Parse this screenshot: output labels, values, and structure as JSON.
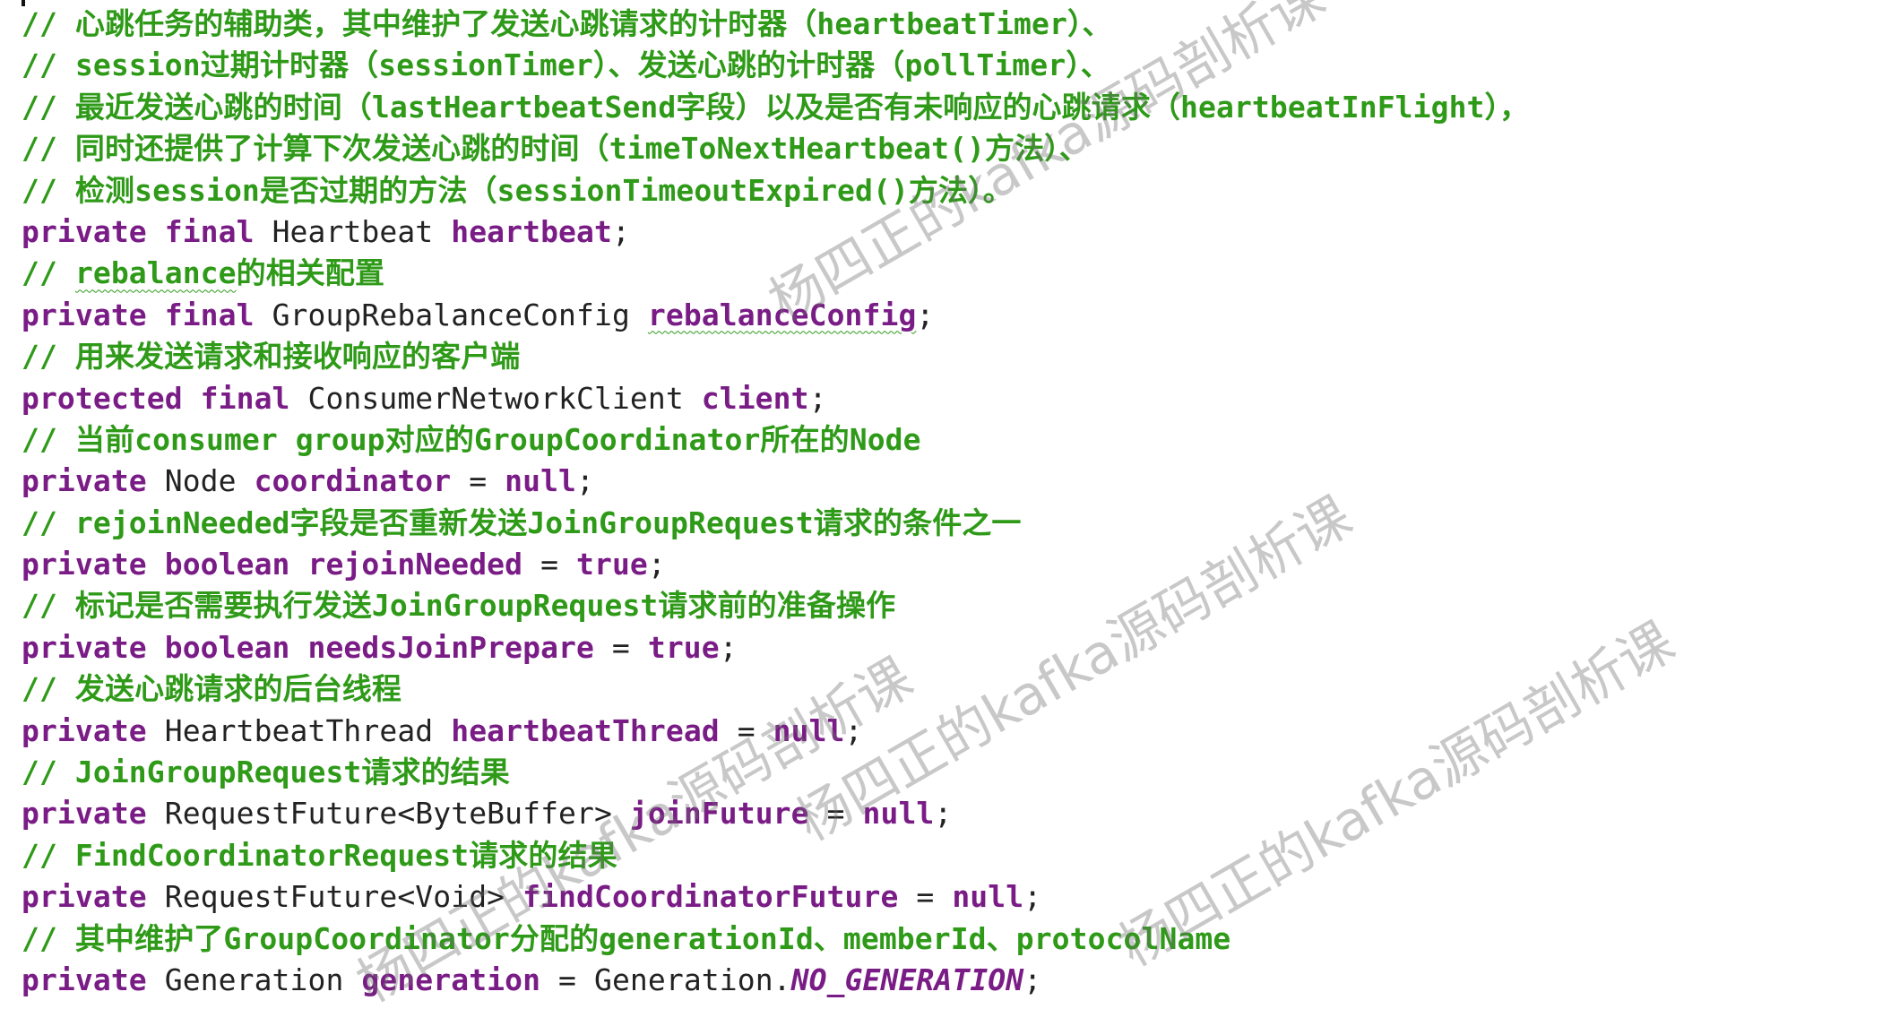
{
  "editor": {
    "lines": [
      {
        "kind": "comment",
        "tokens": [
          {
            "t": "// 心跳任务的辅助类，其中维护了发送心跳请求的计时器（heartbeatTimer）、",
            "c": "comment"
          }
        ]
      },
      {
        "kind": "comment",
        "tokens": [
          {
            "t": "// session过期计时器（sessionTimer）、发送心跳的计时器（pollTimer）、",
            "c": "comment"
          }
        ]
      },
      {
        "kind": "comment",
        "tokens": [
          {
            "t": "// 最近发送心跳的时间（lastHeartbeatSend字段）以及是否有未响应的心跳请求（heartbeatInFlight），",
            "c": "comment"
          }
        ]
      },
      {
        "kind": "comment",
        "tokens": [
          {
            "t": "// 同时还提供了计算下次发送心跳的时间（timeToNextHeartbeat()方法）、",
            "c": "comment"
          }
        ]
      },
      {
        "kind": "comment",
        "tokens": [
          {
            "t": "// 检测session是否过期的方法（sessionTimeoutExpired()方法）。",
            "c": "comment"
          }
        ]
      },
      {
        "kind": "code",
        "tokens": [
          {
            "t": "private final ",
            "c": "keyword"
          },
          {
            "t": "Heartbeat ",
            "c": "plain"
          },
          {
            "t": "heartbeat",
            "c": "field"
          },
          {
            "t": ";",
            "c": "plain"
          }
        ]
      },
      {
        "kind": "comment",
        "tokens": [
          {
            "t": "// ",
            "c": "comment"
          },
          {
            "t": "rebalance",
            "c": "comment",
            "squiggle": true
          },
          {
            "t": "的相关配置",
            "c": "comment"
          }
        ]
      },
      {
        "kind": "code",
        "tokens": [
          {
            "t": "private final ",
            "c": "keyword"
          },
          {
            "t": "GroupRebalanceConfig ",
            "c": "plain"
          },
          {
            "t": "rebalanceConfig",
            "c": "field",
            "squiggle": true
          },
          {
            "t": ";",
            "c": "plain"
          }
        ]
      },
      {
        "kind": "comment",
        "tokens": [
          {
            "t": "// 用来发送请求和接收响应的客户端",
            "c": "comment"
          }
        ]
      },
      {
        "kind": "code",
        "tokens": [
          {
            "t": "protected final ",
            "c": "keyword"
          },
          {
            "t": "ConsumerNetworkClient ",
            "c": "plain"
          },
          {
            "t": "client",
            "c": "field"
          },
          {
            "t": ";",
            "c": "plain"
          }
        ]
      },
      {
        "kind": "comment",
        "tokens": [
          {
            "t": "// 当前consumer group对应的GroupCoordinator所在的Node",
            "c": "comment"
          }
        ]
      },
      {
        "kind": "code",
        "tokens": [
          {
            "t": "private ",
            "c": "keyword"
          },
          {
            "t": "Node ",
            "c": "plain"
          },
          {
            "t": "coordinator",
            "c": "field"
          },
          {
            "t": " = ",
            "c": "plain"
          },
          {
            "t": "null",
            "c": "keyword"
          },
          {
            "t": ";",
            "c": "plain"
          }
        ]
      },
      {
        "kind": "comment",
        "tokens": [
          {
            "t": "// rejoinNeeded字段是否重新发送JoinGroupRequest请求的条件之一",
            "c": "comment"
          }
        ]
      },
      {
        "kind": "code",
        "tokens": [
          {
            "t": "private boolean ",
            "c": "keyword"
          },
          {
            "t": "rejoinNeeded",
            "c": "field"
          },
          {
            "t": " = ",
            "c": "plain"
          },
          {
            "t": "true",
            "c": "keyword"
          },
          {
            "t": ";",
            "c": "plain"
          }
        ]
      },
      {
        "kind": "comment",
        "tokens": [
          {
            "t": "// 标记是否需要执行发送JoinGroupRequest请求前的准备操作",
            "c": "comment"
          }
        ]
      },
      {
        "kind": "code",
        "tokens": [
          {
            "t": "private boolean ",
            "c": "keyword"
          },
          {
            "t": "needsJoinPrepare",
            "c": "field"
          },
          {
            "t": " = ",
            "c": "plain"
          },
          {
            "t": "true",
            "c": "keyword"
          },
          {
            "t": ";",
            "c": "plain"
          }
        ]
      },
      {
        "kind": "comment",
        "tokens": [
          {
            "t": "// 发送心跳请求的后台线程",
            "c": "comment"
          }
        ]
      },
      {
        "kind": "code",
        "tokens": [
          {
            "t": "private ",
            "c": "keyword"
          },
          {
            "t": "HeartbeatThread ",
            "c": "plain"
          },
          {
            "t": "heartbeatThread",
            "c": "field"
          },
          {
            "t": " = ",
            "c": "plain"
          },
          {
            "t": "null",
            "c": "keyword"
          },
          {
            "t": ";",
            "c": "plain"
          }
        ]
      },
      {
        "kind": "comment",
        "tokens": [
          {
            "t": "// JoinGroupRequest请求的结果",
            "c": "comment"
          }
        ]
      },
      {
        "kind": "code",
        "tokens": [
          {
            "t": "private ",
            "c": "keyword"
          },
          {
            "t": "RequestFuture<ByteBuffer> ",
            "c": "plain"
          },
          {
            "t": "joinFuture",
            "c": "field"
          },
          {
            "t": " = ",
            "c": "plain"
          },
          {
            "t": "null",
            "c": "keyword"
          },
          {
            "t": ";",
            "c": "plain"
          }
        ]
      },
      {
        "kind": "comment",
        "tokens": [
          {
            "t": "// FindCoordinatorRequest请求的结果",
            "c": "comment"
          }
        ]
      },
      {
        "kind": "code",
        "tokens": [
          {
            "t": "private ",
            "c": "keyword"
          },
          {
            "t": "RequestFuture<Void> ",
            "c": "plain"
          },
          {
            "t": "findCoordinatorFuture",
            "c": "field"
          },
          {
            "t": " = ",
            "c": "plain"
          },
          {
            "t": "null",
            "c": "keyword"
          },
          {
            "t": ";",
            "c": "plain"
          }
        ]
      },
      {
        "kind": "comment",
        "tokens": [
          {
            "t": "// 其中维护了GroupCoordinator分配的generationId、memberId、protocolName",
            "c": "comment"
          }
        ]
      },
      {
        "kind": "code",
        "tokens": [
          {
            "t": "private ",
            "c": "keyword"
          },
          {
            "t": "Generation ",
            "c": "plain"
          },
          {
            "t": "generation",
            "c": "field"
          },
          {
            "t": " = Generation.",
            "c": "plain"
          },
          {
            "t": "NO_GENERATION",
            "c": "const"
          },
          {
            "t": ";",
            "c": "plain"
          }
        ]
      }
    ]
  },
  "watermark": {
    "text": "杨四正的kafka源码剖析课"
  },
  "colors": {
    "comment": "#2e9a18",
    "keyword": "#7a1c86",
    "plain": "#222222",
    "background": "#ffffff"
  }
}
